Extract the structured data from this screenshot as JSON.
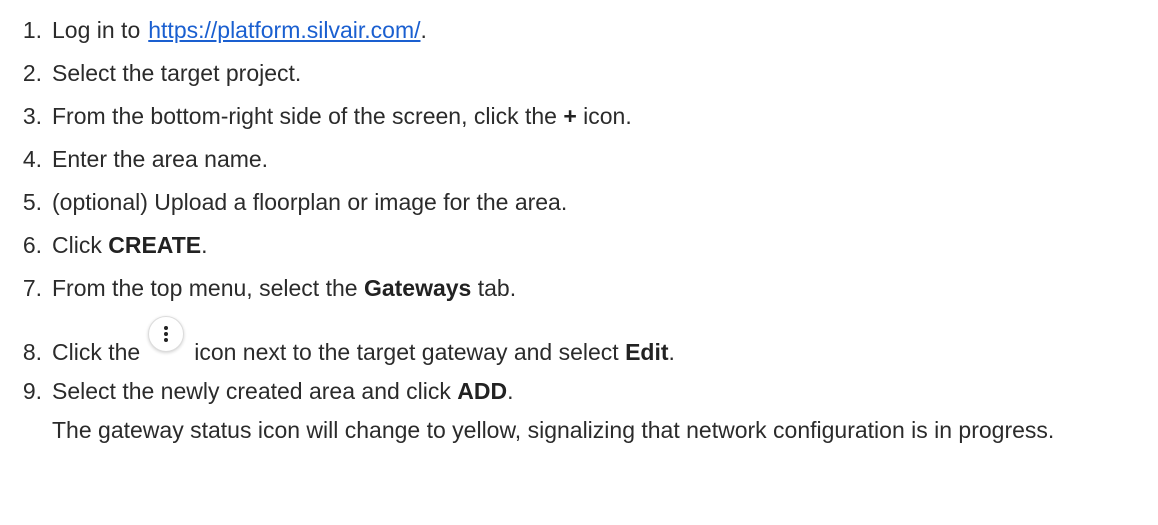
{
  "steps": [
    {
      "num": "1.",
      "pre": "Log in to",
      "link": "https://platform.silvair.com/",
      "post": "."
    },
    {
      "num": "2.",
      "text": "Select the target project."
    },
    {
      "num": "3.",
      "pre": "From the bottom-right side of the screen, click the",
      "bold": "+",
      "post": "icon."
    },
    {
      "num": "4.",
      "text": "Enter the area name."
    },
    {
      "num": "5.",
      "text": "(optional) Upload a floorplan or image for the area."
    },
    {
      "num": "6.",
      "pre": "Click",
      "bold": "CREATE",
      "post": "."
    },
    {
      "num": "7.",
      "pre": "From the top menu, select the",
      "bold": "Gateways",
      "post": "tab."
    },
    {
      "num": "8.",
      "pre": "Click the",
      "icon": "more-vertical-icon",
      "mid": "icon next to the target gateway and select",
      "bold": "Edit",
      "post": "."
    },
    {
      "num": "9.",
      "pre": "Select the newly created area and click",
      "bold": "ADD",
      "post": "."
    }
  ],
  "note": "The gateway status icon will change to yellow, signalizing that network configuration is in progress."
}
